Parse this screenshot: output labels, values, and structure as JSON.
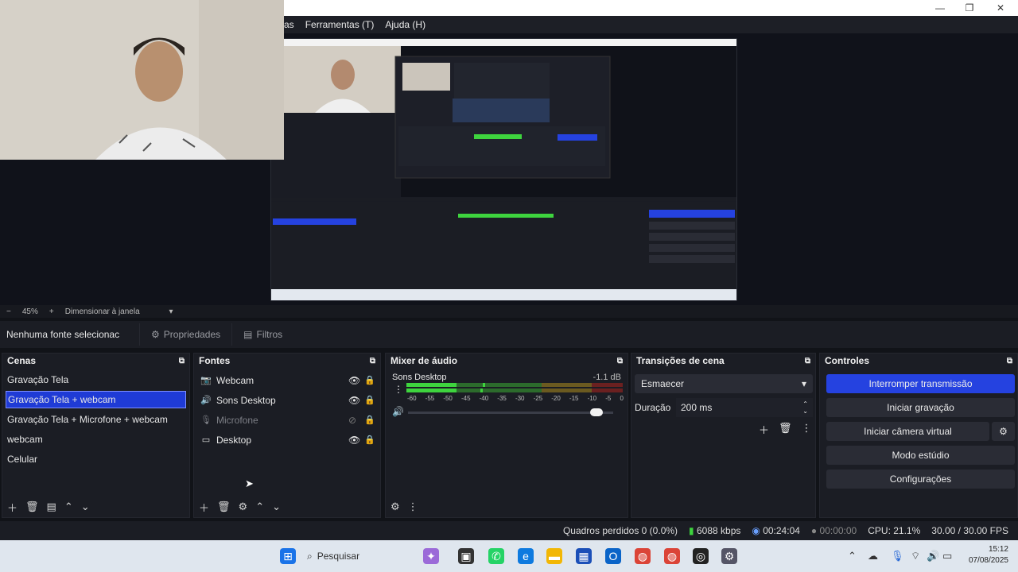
{
  "window": {
    "menu": [
      "as",
      "Ferramentas (T)",
      "Ajuda (H)"
    ],
    "minimize": "—",
    "maximize": "❐",
    "close": "✕"
  },
  "zoom": {
    "minus": "−",
    "value": "45%",
    "plus": "+",
    "mode": "Dimensionar à janela"
  },
  "context": {
    "no_source": "Nenhuma fonte selecionac",
    "properties": "Propriedades",
    "filters": "Filtros"
  },
  "scenes": {
    "title": "Cenas",
    "items": [
      "Gravação Tela",
      "Gravação Tela + webcam",
      "Gravação Tela + Microfone + webcam",
      "webcam",
      "Celular"
    ],
    "selected_index": 1
  },
  "sources": {
    "title": "Fontes",
    "items": [
      {
        "icon": "camera-icon",
        "label": "Webcam",
        "visible": true
      },
      {
        "icon": "speaker-icon",
        "label": "Sons Desktop",
        "visible": true
      },
      {
        "icon": "microphone-icon",
        "label": "Microfone",
        "visible": false
      },
      {
        "icon": "monitor-icon",
        "label": "Desktop",
        "visible": true
      }
    ]
  },
  "mixer": {
    "title": "Mixer de áudio",
    "channel": "Sons Desktop",
    "db": "-1.1 dB",
    "scale": [
      "-60",
      "-55",
      "-50",
      "-45",
      "-40",
      "-35",
      "-30",
      "-25",
      "-20",
      "-15",
      "-10",
      "-5",
      "0"
    ],
    "volume_fraction": 0.92
  },
  "transitions": {
    "title": "Transições de cena",
    "selected": "Esmaecer",
    "duration_label": "Duração",
    "duration_value": "200 ms"
  },
  "controls": {
    "title": "Controles",
    "stop_stream": "Interromper transmissão",
    "start_recording": "Iniciar gravação",
    "virtual_camera": "Iniciar câmera virtual",
    "studio_mode": "Modo estúdio",
    "settings": "Configurações"
  },
  "status": {
    "dropped": "Quadros perdidos 0 (0.0%)",
    "bitrate": "6088 kbps",
    "stream_time": "00:24:04",
    "rec_time": "00:00:00",
    "cpu": "CPU: 21.1%",
    "fps": "30.00 / 30.00 FPS"
  },
  "taskbar": {
    "search": "Pesquisar",
    "time": "15:12",
    "date": "07/08/2025"
  },
  "colors": {
    "accent": "#2542e0",
    "panel": "#1b1d24",
    "meter_green": "#3ed43e",
    "meter_yellow": "#c9a227",
    "meter_red": "#d63636"
  }
}
